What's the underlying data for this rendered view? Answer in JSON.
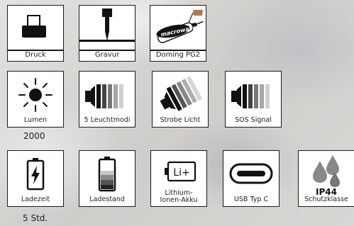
{
  "row1": [
    {
      "icon": "printer-icon",
      "label": "Druck"
    },
    {
      "icon": "engraving-tool-icon",
      "label": "Gravur"
    },
    {
      "icon": "macrowave-doming-pen-icon",
      "label": "Doming PG2",
      "badge": "macrowave"
    }
  ],
  "row2": [
    {
      "icon": "sun-icon",
      "label": "Lumen"
    },
    {
      "icon": "flashlight-modes-icon",
      "label": "5 Leuchtmodi"
    },
    {
      "icon": "strobe-light-icon",
      "label": "Strobe Licht"
    },
    {
      "icon": "sos-signal-icon",
      "label": "SOS Signal"
    }
  ],
  "row3": [
    {
      "icon": "battery-charging-icon",
      "label": "Ladezeit"
    },
    {
      "icon": "battery-level-icon",
      "label": "Ladestand"
    },
    {
      "icon": "lithium-battery-icon",
      "label": "Lithium-Ionen-Akku",
      "line1": "Lithium-",
      "line2": "Ionen-Akku",
      "badge": "Li+"
    },
    {
      "icon": "usb-c-icon",
      "label": "USB Typ C"
    },
    {
      "icon": "water-drops-icon",
      "label": "Schutzklasse",
      "badge": "IP44"
    }
  ],
  "values": {
    "lumen": "2000",
    "ladezeit": "5 Std."
  }
}
